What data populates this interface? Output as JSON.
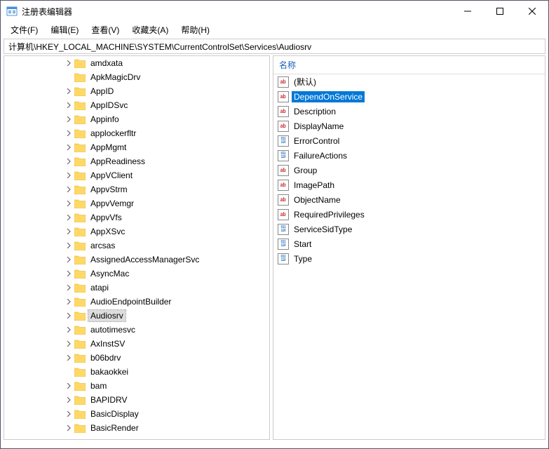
{
  "window": {
    "title": "注册表编辑器"
  },
  "menu": {
    "file": "文件(F)",
    "edit": "编辑(E)",
    "view": "查看(V)",
    "favorites": "收藏夹(A)",
    "help": "帮助(H)"
  },
  "address": "计算机\\HKEY_LOCAL_MACHINE\\SYSTEM\\CurrentControlSet\\Services\\Audiosrv",
  "tree": [
    {
      "label": "amdxata",
      "expand": true
    },
    {
      "label": "ApkMagicDrv",
      "expand": false
    },
    {
      "label": "AppID",
      "expand": true
    },
    {
      "label": "AppIDSvc",
      "expand": true
    },
    {
      "label": "Appinfo",
      "expand": true
    },
    {
      "label": "applockerfltr",
      "expand": true
    },
    {
      "label": "AppMgmt",
      "expand": true
    },
    {
      "label": "AppReadiness",
      "expand": true
    },
    {
      "label": "AppVClient",
      "expand": true
    },
    {
      "label": "AppvStrm",
      "expand": true
    },
    {
      "label": "AppvVemgr",
      "expand": true
    },
    {
      "label": "AppvVfs",
      "expand": true
    },
    {
      "label": "AppXSvc",
      "expand": true
    },
    {
      "label": "arcsas",
      "expand": true
    },
    {
      "label": "AssignedAccessManagerSvc",
      "expand": true
    },
    {
      "label": "AsyncMac",
      "expand": true
    },
    {
      "label": "atapi",
      "expand": true
    },
    {
      "label": "AudioEndpointBuilder",
      "expand": true
    },
    {
      "label": "Audiosrv",
      "expand": true,
      "selected": true
    },
    {
      "label": "autotimesvc",
      "expand": true
    },
    {
      "label": "AxInstSV",
      "expand": true
    },
    {
      "label": "b06bdrv",
      "expand": true
    },
    {
      "label": "bakaokkei",
      "expand": false
    },
    {
      "label": "bam",
      "expand": true
    },
    {
      "label": "BAPIDRV",
      "expand": true
    },
    {
      "label": "BasicDisplay",
      "expand": true
    },
    {
      "label": "BasicRender",
      "expand": true
    }
  ],
  "list": {
    "header_name": "名称",
    "values": [
      {
        "name": "(默认)",
        "type": "str"
      },
      {
        "name": "DependOnService",
        "type": "str",
        "selected": true
      },
      {
        "name": "Description",
        "type": "str"
      },
      {
        "name": "DisplayName",
        "type": "str"
      },
      {
        "name": "ErrorControl",
        "type": "bin"
      },
      {
        "name": "FailureActions",
        "type": "bin"
      },
      {
        "name": "Group",
        "type": "str"
      },
      {
        "name": "ImagePath",
        "type": "str"
      },
      {
        "name": "ObjectName",
        "type": "str"
      },
      {
        "name": "RequiredPrivileges",
        "type": "str"
      },
      {
        "name": "ServiceSidType",
        "type": "bin"
      },
      {
        "name": "Start",
        "type": "bin"
      },
      {
        "name": "Type",
        "type": "bin"
      }
    ]
  }
}
